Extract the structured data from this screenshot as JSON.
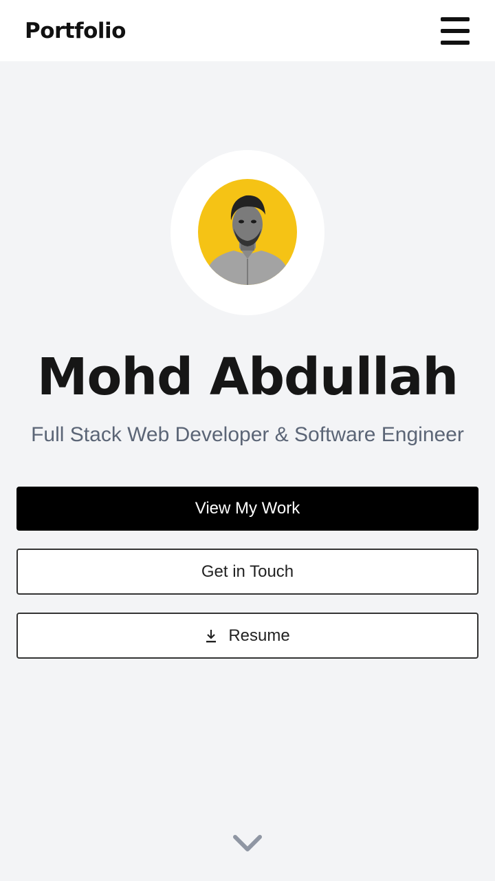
{
  "navbar": {
    "brand": "Portfolio",
    "menu_icon": "hamburger-menu-icon"
  },
  "hero": {
    "avatar_alt": "profile-photo",
    "name": "Mohd Abdullah",
    "subtitle": "Full Stack Web Developer & Software Engineer"
  },
  "buttons": {
    "view_work": "View My Work",
    "get_in_touch": "Get in Touch",
    "resume": "Resume",
    "resume_icon": "download-icon"
  },
  "scroll_icon": "chevron-down-icon",
  "colors": {
    "background": "#f3f4f6",
    "avatar_bg": "#f5c315",
    "primary_button": "#000000",
    "subtitle": "#5b6576"
  }
}
